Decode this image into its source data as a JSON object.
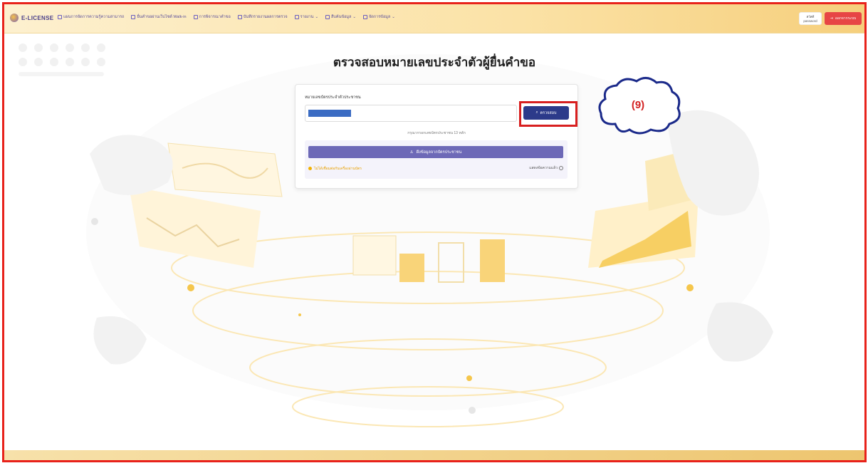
{
  "app": {
    "logo_text": "E-LICENSE"
  },
  "nav": {
    "items": [
      {
        "label": "แผนการจัดการความรู้ความสามารถ",
        "icon": "grid-icon"
      },
      {
        "label": "ยื่นคำขอผ่านเว็บไซต์ Walk-in",
        "icon": "user-add-icon"
      },
      {
        "label": "การพิจารณาคำขอ",
        "icon": "doc-icon"
      },
      {
        "label": "บันทึกรายงานผลการตรวจ",
        "icon": "clipboard-icon"
      },
      {
        "label": "รายงาน",
        "icon": "chart-icon"
      },
      {
        "label": "สืบค้นข้อมูล",
        "icon": "search-icon"
      },
      {
        "label": "จัดการข้อมูล",
        "icon": "gear-icon"
      }
    ],
    "user_label": "สวัสดี\npassword",
    "logout_label": "ออกจากระบบ"
  },
  "page": {
    "title": "ตรวจสอบหมายเลขประจำตัวผู้ยื่นคำขอ"
  },
  "form": {
    "field_label": "หมายเลขบัตรประจำตัวประชาชน",
    "search_label": "ตรวจสอบ",
    "hint": "กรุณากรอกเลขบัตรประชาชน 13 หลัก",
    "extract_label": "ดึงข้อมูลจากบัตรประชาชน",
    "status_text": "ไม่ได้เชื่อมต่อกับเครื่องอ่านบัตร",
    "status_right": "แสดงข้อความแล้ว"
  },
  "annotation": {
    "label": "(9)"
  },
  "colors": {
    "accent": "#2c3a8a",
    "highlight": "#d81f1f",
    "header_gradient_start": "#fdf0cf",
    "header_gradient_end": "#f6cf7c"
  }
}
